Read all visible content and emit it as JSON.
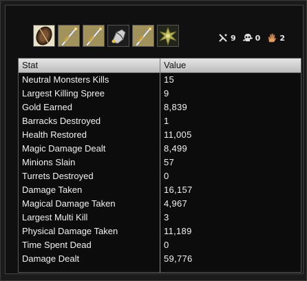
{
  "items": [
    {
      "icon": "shield-item-icon"
    },
    {
      "icon": "sword-item-icon"
    },
    {
      "icon": "sword-item-icon"
    },
    {
      "icon": "gauntlet-item-icon"
    },
    {
      "icon": "sword-item-icon"
    },
    {
      "icon": "thornmail-item-icon"
    }
  ],
  "summary": {
    "kills": {
      "icon": "kills-icon",
      "value": "9"
    },
    "deaths": {
      "icon": "skull-icon",
      "value": "0"
    },
    "assists": {
      "icon": "hand-icon",
      "value": "2"
    }
  },
  "table": {
    "headers": {
      "stat": "Stat",
      "value": "Value"
    },
    "rows": [
      {
        "stat": "Neutral Monsters Kills",
        "value": "15"
      },
      {
        "stat": "Largest Killing Spree",
        "value": "9"
      },
      {
        "stat": "Gold Earned",
        "value": "8,839"
      },
      {
        "stat": "Barracks Destroyed",
        "value": "1"
      },
      {
        "stat": "Health Restored",
        "value": "11,005"
      },
      {
        "stat": "Magic Damage Dealt",
        "value": "8,499"
      },
      {
        "stat": "Minions Slain",
        "value": "57"
      },
      {
        "stat": "Turrets Destroyed",
        "value": "0"
      },
      {
        "stat": "Damage Taken",
        "value": "16,157"
      },
      {
        "stat": "Magical Damage Taken",
        "value": "4,967"
      },
      {
        "stat": "Largest Multi Kill",
        "value": "3"
      },
      {
        "stat": "Physical Damage Taken",
        "value": "11,189"
      },
      {
        "stat": "Time Spent Dead",
        "value": "0"
      },
      {
        "stat": "Damage Dealt",
        "value": "59,776"
      }
    ]
  }
}
